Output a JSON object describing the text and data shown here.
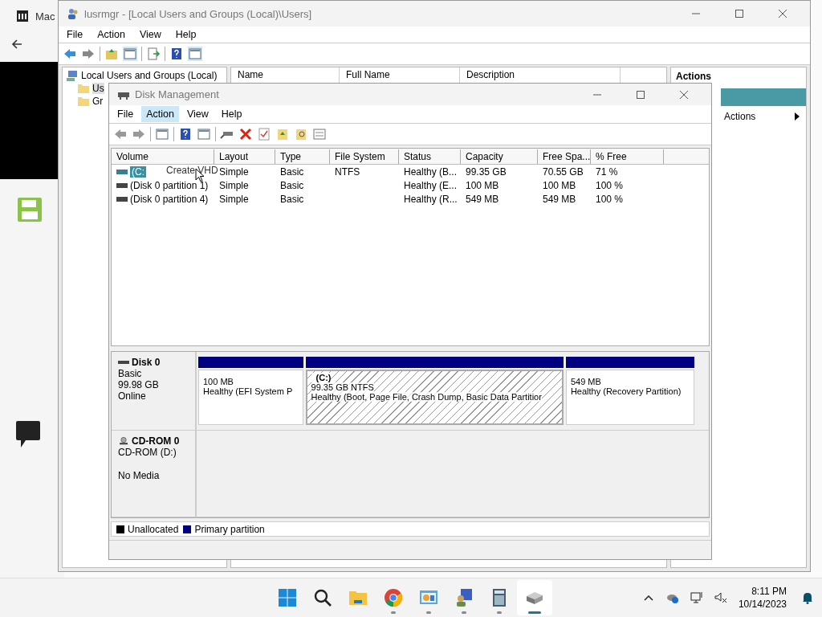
{
  "browser": {
    "tab_title": "Mac"
  },
  "lusrmgr": {
    "title": "lusrmgr - [Local Users and Groups (Local)\\Users]",
    "menu": [
      "File",
      "Action",
      "View",
      "Help"
    ],
    "tree": [
      {
        "label": "Local Users and Groups (Local)",
        "children": [
          {
            "label": "Us",
            "selected": true
          },
          {
            "label": "Gr",
            "selected": false
          }
        ]
      }
    ],
    "columns": [
      "Name",
      "Full Name",
      "Description"
    ],
    "actions": {
      "header": "Actions",
      "items": [
        {
          "label": "Actions",
          "kind": "submenu"
        }
      ]
    }
  },
  "disk_management": {
    "title": "Disk Management",
    "menu": [
      {
        "label": "File",
        "selected": false
      },
      {
        "label": "Action",
        "selected": true
      },
      {
        "label": "View",
        "selected": false
      },
      {
        "label": "Help",
        "selected": false
      }
    ],
    "columns": [
      "Volume",
      "Layout",
      "Type",
      "File System",
      "Status",
      "Capacity",
      "Free Spa...",
      "% Free"
    ],
    "rows": [
      {
        "selected": true,
        "cells": [
          "(C:",
          "Simple",
          "Basic",
          "NTFS",
          "Healthy (B...",
          "99.35 GB",
          "70.55 GB",
          "71 %"
        ]
      },
      {
        "selected": false,
        "cells": [
          "(Disk 0 partition 1)",
          "Simple",
          "Basic",
          "",
          "Healthy (E...",
          "100 MB",
          "100 MB",
          "100 %"
        ]
      },
      {
        "selected": false,
        "cells": [
          "(Disk 0 partition 4)",
          "Simple",
          "Basic",
          "",
          "Healthy (R...",
          "549 MB",
          "549 MB",
          "100 %"
        ]
      }
    ],
    "drag_label": "Create VHD",
    "disks": [
      {
        "kind": "disk",
        "name": "Disk 0",
        "lines": [
          "Basic",
          "99.98 GB",
          "Online"
        ],
        "partitions": [
          {
            "kind": "primary",
            "size": "100 MB",
            "status": "Healthy (EFI System P",
            "selected": false
          },
          {
            "kind": "primary",
            "label": "(C:)",
            "size": "99.35 GB NTFS",
            "status": "Healthy (Boot, Page File, Crash Dump, Basic Data Partitior",
            "selected": true
          },
          {
            "kind": "primary",
            "size": "549 MB",
            "status": "Healthy (Recovery Partition)",
            "selected": false
          }
        ]
      },
      {
        "kind": "cdrom",
        "name": "CD-ROM 0",
        "lines": [
          "CD-ROM (D:)",
          "No Media"
        ]
      }
    ],
    "legend": [
      {
        "label": "Unallocated",
        "color": "#000000"
      },
      {
        "label": "Primary partition",
        "color": "#000080"
      }
    ]
  },
  "taskbar": {
    "apps": [
      {
        "kind": "start",
        "running": false,
        "selected": false
      },
      {
        "kind": "search",
        "running": false,
        "selected": false
      },
      {
        "kind": "files",
        "running": false,
        "selected": false
      },
      {
        "kind": "chrome",
        "running": true,
        "selected": false
      },
      {
        "kind": "control",
        "running": true,
        "selected": false
      },
      {
        "kind": "users",
        "running": true,
        "selected": false
      },
      {
        "kind": "calculator",
        "running": true,
        "selected": false
      },
      {
        "kind": "disk",
        "running": true,
        "selected": true
      }
    ],
    "time": "8:11 PM",
    "date": "10/14/2023"
  }
}
